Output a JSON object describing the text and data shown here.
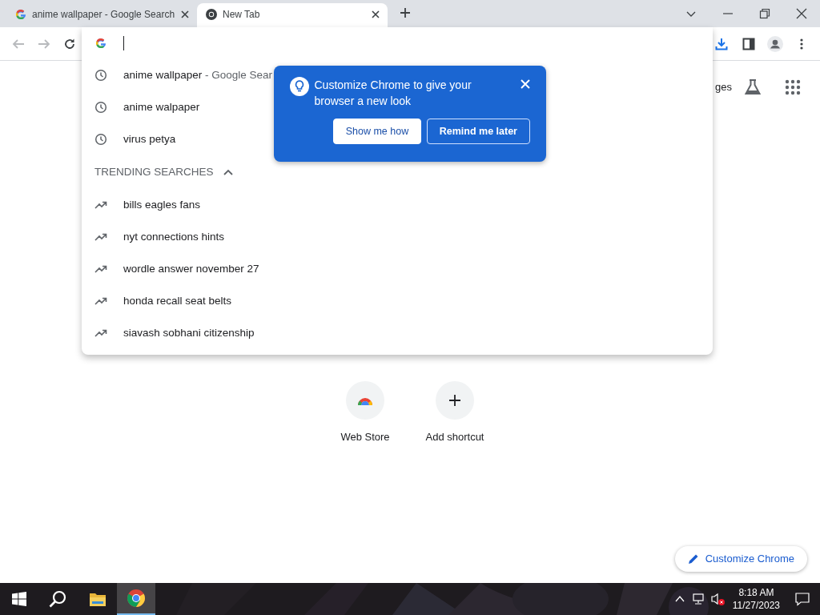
{
  "tabs": [
    {
      "title": "anime wallpaper - Google Search",
      "kind": "google",
      "selected": false
    },
    {
      "title": "New Tab",
      "kind": "chrome",
      "selected": true
    }
  ],
  "omnibox": {
    "focused": true
  },
  "suggestions": [
    {
      "kind": "history",
      "text": "anime wallpaper",
      "detail": "- Google Sear"
    },
    {
      "kind": "history",
      "text": "anime walpaper"
    },
    {
      "kind": "history",
      "text": "virus petya"
    }
  ],
  "trending": {
    "heading": "TRENDING SEARCHES",
    "expanded": true,
    "items": [
      "bills eagles fans",
      "nyt connections hints",
      "wordle answer november 27",
      "honda recall seat belts",
      "siavash sobhani citizenship"
    ]
  },
  "promo": {
    "message": "Customize Chrome to give your browser a new look",
    "buttons": [
      {
        "label": "Show me how",
        "kind": "secondary"
      },
      {
        "label": "Remind me later",
        "kind": "primary"
      }
    ]
  },
  "header_link": "ges",
  "shortcuts": [
    {
      "label": "Web Store",
      "kind": "webstore"
    },
    {
      "label": "Add shortcut",
      "kind": "add"
    }
  ],
  "customize_button": "Customize Chrome",
  "taskbar": {
    "apps": [
      {
        "kind": "start",
        "selected": false
      },
      {
        "kind": "search",
        "selected": false
      },
      {
        "kind": "explorer",
        "selected": false
      },
      {
        "kind": "chrome",
        "selected": true
      }
    ],
    "time": "8:18 AM",
    "date": "11/27/2023"
  }
}
